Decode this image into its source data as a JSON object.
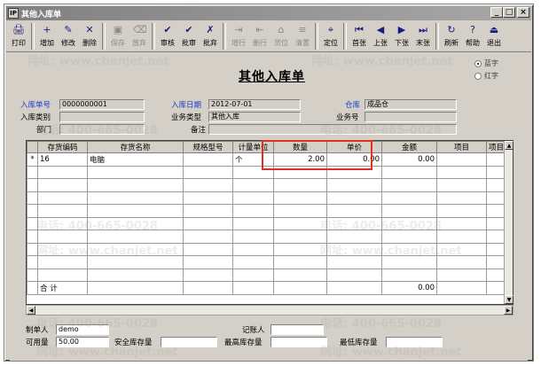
{
  "window": {
    "title": "其他入库单",
    "app_icon": "IP",
    "buttons": [
      "_",
      "□",
      "×"
    ]
  },
  "toolbar": [
    {
      "label": "打印",
      "icon": "printer-icon",
      "glyph": "🖨",
      "enabled": true
    },
    {
      "label": "增加",
      "icon": "add-icon",
      "glyph": "+",
      "enabled": true
    },
    {
      "label": "修改",
      "icon": "edit-icon",
      "glyph": "✎",
      "enabled": true
    },
    {
      "label": "删除",
      "icon": "delete-icon",
      "glyph": "✕",
      "enabled": true
    },
    {
      "label": "保存",
      "icon": "save-icon",
      "glyph": "▣",
      "enabled": false
    },
    {
      "label": "放弃",
      "icon": "discard-icon",
      "glyph": "⌫",
      "enabled": false
    },
    {
      "label": "审核",
      "icon": "audit-icon",
      "glyph": "✔",
      "enabled": true
    },
    {
      "label": "批审",
      "icon": "batch-audit-icon",
      "glyph": "✔",
      "enabled": true
    },
    {
      "label": "批弃",
      "icon": "batch-abandon-icon",
      "glyph": "✗",
      "enabled": true
    },
    {
      "label": "增行",
      "icon": "add-row-icon",
      "glyph": "⇥",
      "enabled": false
    },
    {
      "label": "删行",
      "icon": "delete-row-icon",
      "glyph": "⇤",
      "enabled": false
    },
    {
      "label": "货位",
      "icon": "location-icon",
      "glyph": "⌂",
      "enabled": false
    },
    {
      "label": "清置",
      "icon": "clear-icon",
      "glyph": "≡",
      "enabled": false
    },
    {
      "label": "定位",
      "icon": "locate-icon",
      "glyph": "⌖",
      "enabled": true
    },
    {
      "label": "首张",
      "icon": "first-icon",
      "glyph": "⏮",
      "enabled": true
    },
    {
      "label": "上张",
      "icon": "prev-icon",
      "glyph": "◀",
      "enabled": true
    },
    {
      "label": "下张",
      "icon": "next-icon",
      "glyph": "▶",
      "enabled": true
    },
    {
      "label": "末张",
      "icon": "last-icon",
      "glyph": "⏭",
      "enabled": true
    },
    {
      "label": "刷新",
      "icon": "refresh-icon",
      "glyph": "↻",
      "enabled": true
    },
    {
      "label": "帮助",
      "icon": "help-icon",
      "glyph": "?",
      "enabled": true
    },
    {
      "label": "退出",
      "icon": "exit-icon",
      "glyph": "⏏",
      "enabled": true
    }
  ],
  "form": {
    "title": "其他入库单",
    "color_options": {
      "blue": "蓝字",
      "red": "红字",
      "selected": "blue"
    },
    "fields": {
      "receipt_no_label": "入库单号",
      "receipt_no": "0000000001",
      "receipt_date_label": "入库日期",
      "receipt_date": "2012-07-01",
      "warehouse_label": "仓库",
      "warehouse": "成品仓",
      "receipt_type_label": "入库类别",
      "receipt_type": "",
      "business_type_label": "业务类型",
      "business_type": "其他入库",
      "business_no_label": "业务号",
      "business_no": "",
      "department_label": "部门",
      "department": "",
      "remarks_label": "备注",
      "remarks": ""
    }
  },
  "table": {
    "columns": [
      "",
      "存货编码",
      "存货名称",
      "规格型号",
      "计量单位",
      "数量",
      "单价",
      "金额",
      "项目",
      "项目大"
    ],
    "rows": [
      [
        "*",
        "16",
        "电脑",
        "",
        "个",
        "2.00",
        "0.00",
        "0.00",
        "",
        ""
      ]
    ],
    "empty_rows": 9,
    "total_label": "合  计",
    "total_amount": "0.00"
  },
  "footer": {
    "maker_label": "制单人",
    "maker": "demo",
    "bookkeeper_label": "记账人",
    "bookkeeper": "",
    "available_label": "可用量",
    "available": "50.00",
    "safety_stock_label": "安全库存量",
    "safety_stock": "",
    "max_stock_label": "最高库存量",
    "max_stock": "",
    "min_stock_label": "最低库存量",
    "min_stock": ""
  },
  "watermark": {
    "phone": "电话: 400-665-0028",
    "url": "网址: www.chanjet.net"
  },
  "colors": {
    "highlight": "#e03020",
    "label_blue": "#1a3cc8"
  }
}
